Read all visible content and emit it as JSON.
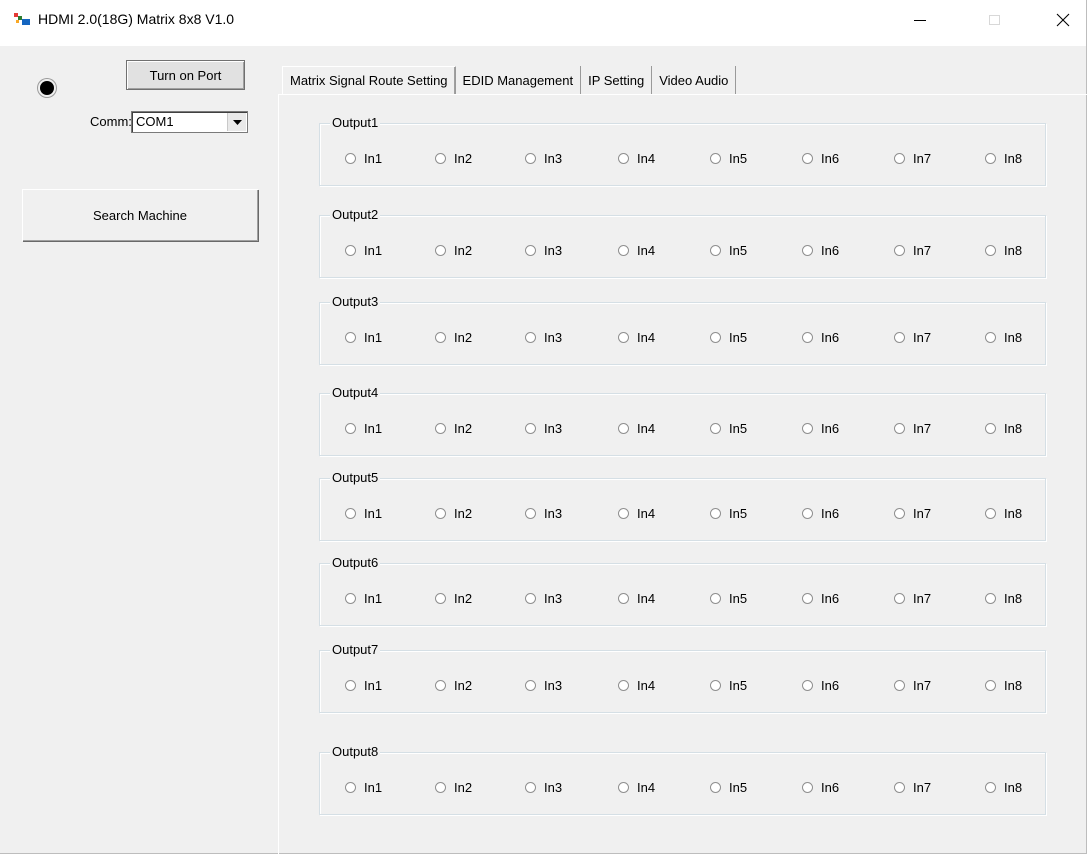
{
  "window": {
    "title": "HDMI 2.0(18G) Matrix 8x8 V1.0"
  },
  "left_panel": {
    "turn_on_label": "Turn on Port",
    "comm_label": "Comm:",
    "comm_value": "COM1",
    "search_label": "Search Machine"
  },
  "tabs": [
    {
      "label": "Matrix Signal Route Setting",
      "active": true
    },
    {
      "label": "EDID Management",
      "active": false
    },
    {
      "label": "IP Setting",
      "active": false
    },
    {
      "label": "Video Audio",
      "active": false
    }
  ],
  "outputs": [
    {
      "label": "Output1",
      "inputs": [
        "In1",
        "In2",
        "In3",
        "In4",
        "In5",
        "In6",
        "In7",
        "In8"
      ]
    },
    {
      "label": "Output2",
      "inputs": [
        "In1",
        "In2",
        "In3",
        "In4",
        "In5",
        "In6",
        "In7",
        "In8"
      ]
    },
    {
      "label": "Output3",
      "inputs": [
        "In1",
        "In2",
        "In3",
        "In4",
        "In5",
        "In6",
        "In7",
        "In8"
      ]
    },
    {
      "label": "Output4",
      "inputs": [
        "In1",
        "In2",
        "In3",
        "In4",
        "In5",
        "In6",
        "In7",
        "In8"
      ]
    },
    {
      "label": "Output5",
      "inputs": [
        "In1",
        "In2",
        "In3",
        "In4",
        "In5",
        "In6",
        "In7",
        "In8"
      ]
    },
    {
      "label": "Output6",
      "inputs": [
        "In1",
        "In2",
        "In3",
        "In4",
        "In5",
        "In6",
        "In7",
        "In8"
      ]
    },
    {
      "label": "Output7",
      "inputs": [
        "In1",
        "In2",
        "In3",
        "In4",
        "In5",
        "In6",
        "In7",
        "In8"
      ]
    },
    {
      "label": "Output8",
      "inputs": [
        "In1",
        "In2",
        "In3",
        "In4",
        "In5",
        "In6",
        "In7",
        "In8"
      ]
    }
  ],
  "icons": {
    "app": "app-icon",
    "minimize": "minimize-icon",
    "maximize": "maximize-icon",
    "close": "close-icon",
    "status": "status-led-icon",
    "dropdown": "chevron-down-icon"
  },
  "colors": {
    "window_bg": "#f0f0f0",
    "titlebar_bg": "#ffffff",
    "led": "#000000"
  }
}
